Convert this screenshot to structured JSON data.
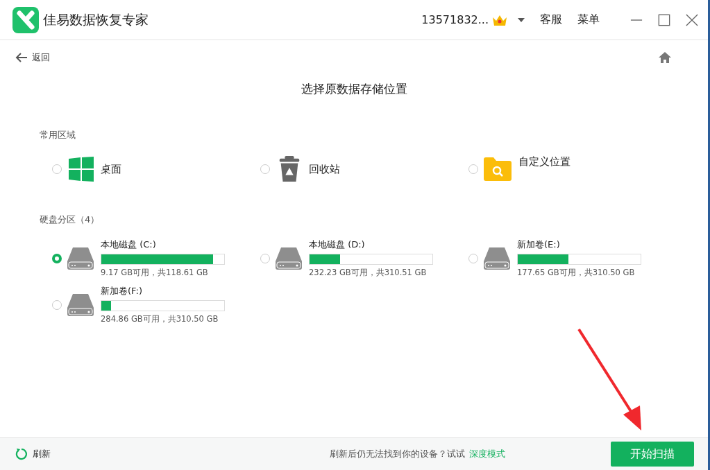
{
  "window": {
    "title": "佳易数据恢复专家",
    "account": "13571832...",
    "menu_items": [
      "客服",
      "菜单"
    ]
  },
  "nav": {
    "back": "返回"
  },
  "heading": "选择原数据存储位置",
  "common": {
    "label": "常用区域",
    "items": [
      {
        "kind": "desktop",
        "label": "桌面",
        "selected": false
      },
      {
        "kind": "recycle",
        "label": "回收站",
        "selected": false
      },
      {
        "kind": "custom",
        "label": "自定义位置",
        "selected": false
      }
    ]
  },
  "disks": {
    "label": "硬盘分区（4）",
    "items": [
      {
        "name": "本地磁盘 (C:)",
        "level": 0.91,
        "usage": "9.17 GB可用，共118.61 GB",
        "selected": true
      },
      {
        "name": "本地磁盘 (D:)",
        "level": 0.25,
        "usage": "232.23 GB可用，共310.51 GB",
        "selected": false
      },
      {
        "name": "新加卷(E:)",
        "level": 0.41,
        "usage": "177.65 GB可用，共310.50 GB",
        "selected": false
      },
      {
        "name": "新加卷(F:)",
        "level": 0.08,
        "usage": "284.86 GB可用，共310.50 GB",
        "selected": false
      }
    ]
  },
  "footer": {
    "refresh": "刷新",
    "hint": "刷新后仍无法找到你的设备？试试",
    "link": "深度模式",
    "start": "开始扫描"
  }
}
